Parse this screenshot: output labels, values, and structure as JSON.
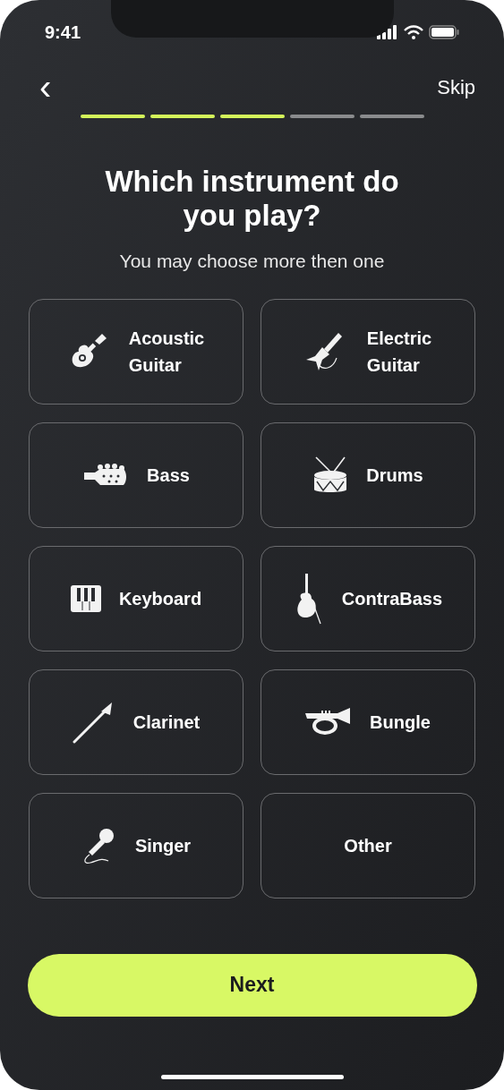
{
  "status_bar": {
    "time": "9:41"
  },
  "header": {
    "back": "‹",
    "skip": "Skip"
  },
  "progress": [
    {
      "done": true
    },
    {
      "done": true
    },
    {
      "done": true
    },
    {
      "done": false
    },
    {
      "done": false
    }
  ],
  "title": "Which instrument do you play?",
  "subtitle": "You may choose more then one",
  "options": [
    {
      "kind": "acoustic",
      "label": "Acoustic Guitar",
      "selected": false
    },
    {
      "kind": "electric",
      "label": "Electric Guitar",
      "selected": false
    },
    {
      "kind": "bass",
      "label": "Bass",
      "selected": false
    },
    {
      "kind": "drums",
      "label": "Drums",
      "selected": false
    },
    {
      "kind": "keyboard",
      "label": "Keyboard",
      "selected": false
    },
    {
      "kind": "contrabass",
      "label": "ContraBass",
      "selected": false
    },
    {
      "kind": "clarinet",
      "label": "Clarinet",
      "selected": false
    },
    {
      "kind": "bugle",
      "label": "Bungle",
      "selected": false
    },
    {
      "kind": "singer",
      "label": "Singer",
      "selected": false
    },
    {
      "kind": "other",
      "label": "Other",
      "selected": false
    }
  ],
  "next_button": "Next"
}
